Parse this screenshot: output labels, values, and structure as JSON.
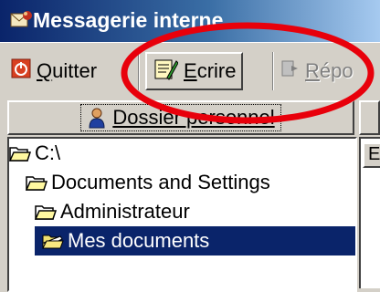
{
  "window": {
    "title": "Messagerie interne"
  },
  "toolbar": {
    "quit": {
      "label_ul": "Q",
      "label_rest": "uitter",
      "icon": "power-icon"
    },
    "write": {
      "label_ul": "E",
      "label_rest": "crire",
      "icon": "write-letter-icon"
    },
    "reply": {
      "label_ul": "R",
      "label_rest": "épo",
      "icon": "reply-icon"
    }
  },
  "folders_panel": {
    "header_label": "Dossier personnel",
    "header_icon": "person-icon",
    "tree": [
      {
        "label": "C:\\",
        "icon": "folder-open-icon",
        "selected": false
      },
      {
        "label": "Documents and Settings",
        "icon": "folder-open-icon",
        "selected": false
      },
      {
        "label": "Administrateur",
        "icon": "folder-open-icon",
        "selected": false
      },
      {
        "label": "Mes documents",
        "icon": "folder-open-icon",
        "selected": true
      }
    ]
  },
  "right_panel": {
    "column_header": "E"
  },
  "colors": {
    "titlebar_start": "#0a246a",
    "selection": "#0a246a",
    "annotation": "#e8000b"
  }
}
